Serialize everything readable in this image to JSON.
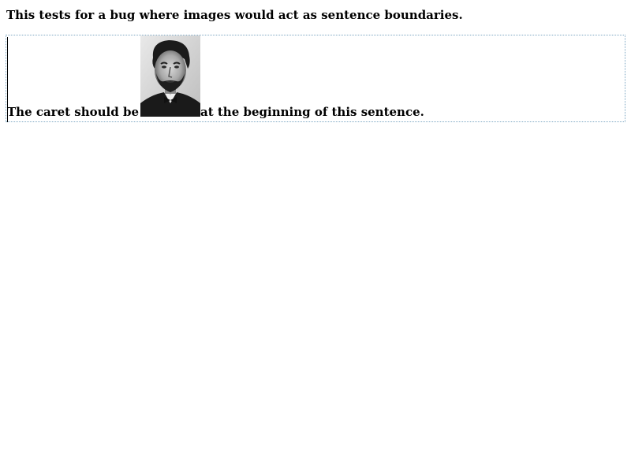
{
  "intro": {
    "text": "This tests for a bug where images would act as sentence boundaries."
  },
  "editor": {
    "before_image": "The caret should be ",
    "after_image": "at the beginning of this sentence.",
    "image_alt": "portrait photo"
  },
  "colors": {
    "editor_border": "#7fa8c4",
    "text": "#000000",
    "background": "#ffffff"
  }
}
